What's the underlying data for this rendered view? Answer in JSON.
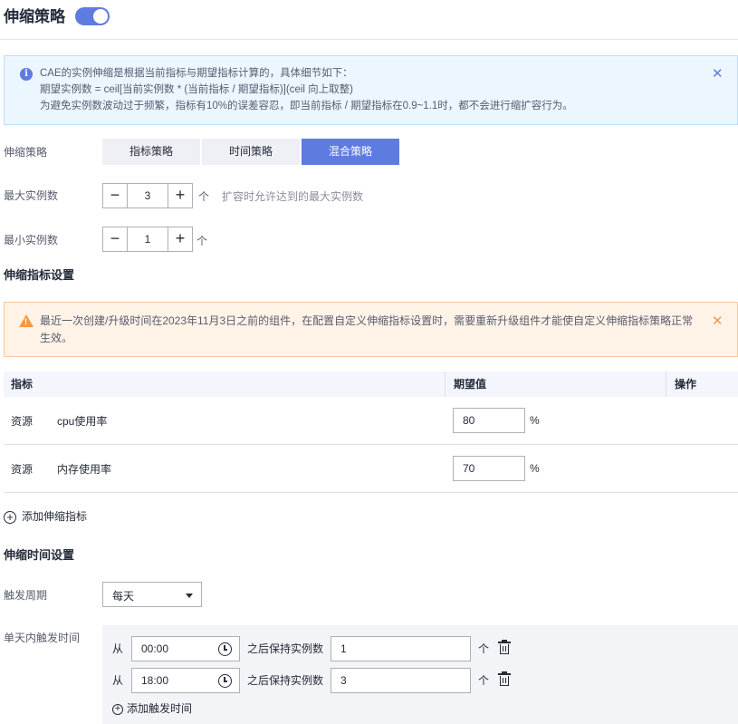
{
  "header": {
    "title": "伸缩策略",
    "enabled": true
  },
  "info_banner": {
    "lines": [
      "CAE的实例伸缩是根据当前指标与期望指标计算的，具体细节如下：",
      "期望实例数 = ceil[当前实例数 * (当前指标 / 期望指标)](ceil 向上取整)",
      "为避免实例数波动过于频繁，指标有10%的误差容忍，即当前指标 / 期望指标在0.9~1.1时，都不会进行缩扩容行为。"
    ],
    "close": "✕"
  },
  "strategy": {
    "label": "伸缩策略",
    "options": [
      "指标策略",
      "时间策略",
      "混合策略"
    ],
    "selected": "混合策略"
  },
  "max_instances": {
    "label": "最大实例数",
    "value": "3",
    "unit": "个",
    "hint": "扩容时允许达到的最大实例数"
  },
  "min_instances": {
    "label": "最小实例数",
    "value": "1",
    "unit": "个"
  },
  "metric_section": {
    "title": "伸缩指标设置"
  },
  "warning_banner": {
    "lines": [
      "最近一次创建/升级时间在2023年11月3日之前的组件，在配置自定义伸缩指标设置时，需要重新升级组件才能使自定义伸缩指标策略正常",
      "生效。"
    ],
    "close": "✕"
  },
  "metric_table": {
    "headers": [
      "指标",
      "期望值",
      "操作"
    ],
    "rows": [
      {
        "type": "资源",
        "metric": "cpu使用率",
        "value": "80",
        "unit": "%"
      },
      {
        "type": "资源",
        "metric": "内存使用率",
        "value": "70",
        "unit": "%"
      }
    ],
    "add_label": "添加伸缩指标"
  },
  "time_section": {
    "title": "伸缩时间设置"
  },
  "trigger_cycle": {
    "label": "触发周期",
    "value": "每天"
  },
  "daily_trigger": {
    "label": "单天内触发时间",
    "from_label": "从",
    "keep_label": "之后保持实例数",
    "unit": "个",
    "entries": [
      {
        "time": "00:00",
        "count": "1"
      },
      {
        "time": "18:00",
        "count": "3"
      }
    ],
    "add_label": "添加触发时间"
  },
  "colors": {
    "primary": "#5e7ce0",
    "info_bg": "#ebf6ff",
    "warn_bg": "#fff3e8",
    "warn_icon": "#fa9841"
  },
  "icons": [
    "info-icon",
    "close-icon",
    "warning-icon",
    "plus-circle-icon",
    "clock-icon",
    "trash-icon",
    "chevron-down-icon"
  ]
}
